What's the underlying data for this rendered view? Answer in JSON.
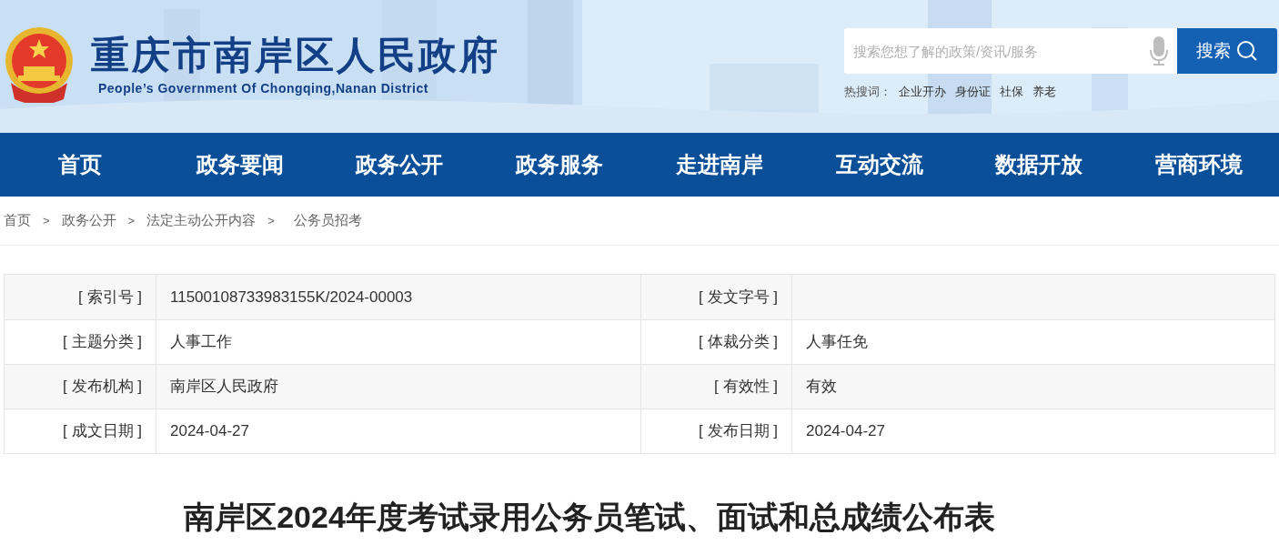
{
  "header": {
    "title": "重庆市南岸区人民政府",
    "subtitle": "People’s Government Of Chongqing,Nanan District",
    "search": {
      "placeholder": "搜索您想了解的政策/资讯/服务",
      "button": "搜索"
    },
    "hot_label": "热搜词：",
    "hot_words": [
      "企业开办",
      "身份证",
      "社保",
      "养老"
    ]
  },
  "nav": [
    "首页",
    "政务要闻",
    "政务公开",
    "政务服务",
    "走进南岸",
    "互动交流",
    "数据开放",
    "营商环境"
  ],
  "breadcrumb": {
    "items": [
      "首页",
      "政务公开",
      "法定主动公开内容",
      "公务员招考"
    ],
    "separator": ">"
  },
  "info_table": {
    "rows": [
      [
        {
          "label": "[ 索引号 ]",
          "value": "11500108733983155K/2024-00003"
        },
        {
          "label": "[ 发文字号 ]"
        }
      ],
      [
        {
          "label": "[ 主题分类 ]",
          "value": "人事工作"
        },
        {
          "label": "[ 体裁分类 ]",
          "value": "人事任免"
        }
      ],
      [
        {
          "label": "[ 发布机构 ]",
          "value": "南岸区人民政府"
        },
        {
          "label": "[ 有效性 ]",
          "value": "有效"
        }
      ],
      [
        {
          "label": "[ 成文日期 ]",
          "value": "2024-04-27"
        },
        {
          "label": "[ 发布日期 ]",
          "value": "2024-04-27"
        }
      ]
    ]
  },
  "article": {
    "title": "南岸区2024年度考试录用公务员笔试、面试和总成绩公布表"
  }
}
